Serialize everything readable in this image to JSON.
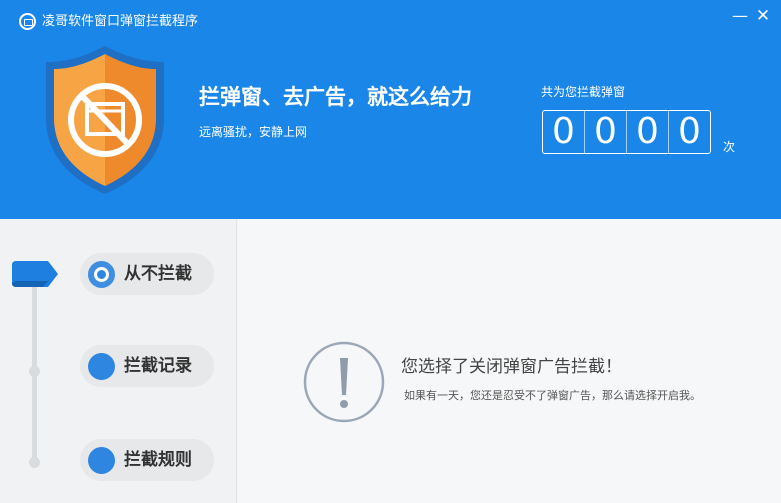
{
  "window": {
    "title": "凌哥软件窗口弹窗拦截程序",
    "minimize_glyph": "—",
    "close_glyph": "✕"
  },
  "banner": {
    "headline": "拦弹窗、去广告，就这么给力",
    "subline": "远离骚扰，安静上网",
    "shield_icon": "blocked-window-shield-icon"
  },
  "counter": {
    "label": "共为您拦截弹窗",
    "digits": [
      "0",
      "0",
      "0",
      "0"
    ],
    "unit": "次"
  },
  "sidebar": {
    "items": [
      {
        "label": "从不拦截",
        "active": true
      },
      {
        "label": "拦截记录",
        "active": false
      },
      {
        "label": "拦截规则",
        "active": false
      }
    ]
  },
  "main": {
    "icon": "exclamation-circle-icon",
    "title": "您选择了关闭弹窗广告拦截！",
    "body": "如果有一天，您还是忍受不了弹窗广告，那么请选择开启我。"
  },
  "colors": {
    "header_blue": "#1a86e8",
    "accent_blue": "#2f86e0",
    "shield_orange": "#f39a3c",
    "sidebar_bg": "#f1f2f3"
  }
}
